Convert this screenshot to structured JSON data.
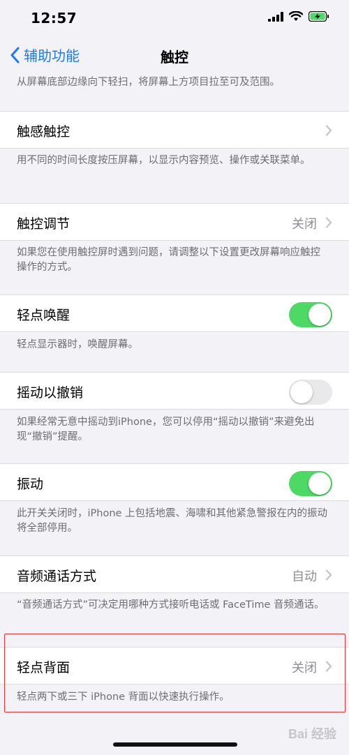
{
  "status": {
    "time": "12:57"
  },
  "nav": {
    "back_label": "辅助功能",
    "title": "触控"
  },
  "top_footnote": "从屏幕底部边缘向下轻扫，将屏幕上方项目拉至可及范围。",
  "rows": [
    {
      "label": "触感触控",
      "value": "",
      "control": "chevron",
      "footnote": "用不同的时间长度按压屏幕，以显示内容预览、操作或关联菜单。"
    },
    {
      "label": "触控调节",
      "value": "关闭",
      "control": "chevron",
      "footnote": "如果您在使用触控屏时遇到问题，请调整以下设置更改屏幕响应触控操作的方式。"
    },
    {
      "label": "轻点唤醒",
      "control": "toggle",
      "on": true,
      "footnote": "轻点显示器时，唤醒屏幕。"
    },
    {
      "label": "摇动以撤销",
      "control": "toggle",
      "on": false,
      "footnote": "如果经常无意中摇动到iPhone，您可以停用“摇动以撤销”来避免出现“撤销”提醒。"
    },
    {
      "label": "振动",
      "control": "toggle",
      "on": true,
      "footnote": "此开关关闭时，iPhone 上包括地震、海啸和其他紧急警报在内的振动将全部停用。"
    },
    {
      "label": "音频通话方式",
      "value": "自动",
      "control": "chevron",
      "footnote": "“音频通话方式”可决定用哪种方式接听电话或 FaceTime 音频通话。"
    },
    {
      "label": "轻点背面",
      "value": "关闭",
      "control": "chevron",
      "footnote": "轻点两下或三下 iPhone 背面以快速执行操作。"
    }
  ],
  "watermark": "Bai 经验",
  "colors": {
    "accent": "#1a7cf5",
    "toggle_on": "#4cd964",
    "highlight": "#e6353b"
  }
}
